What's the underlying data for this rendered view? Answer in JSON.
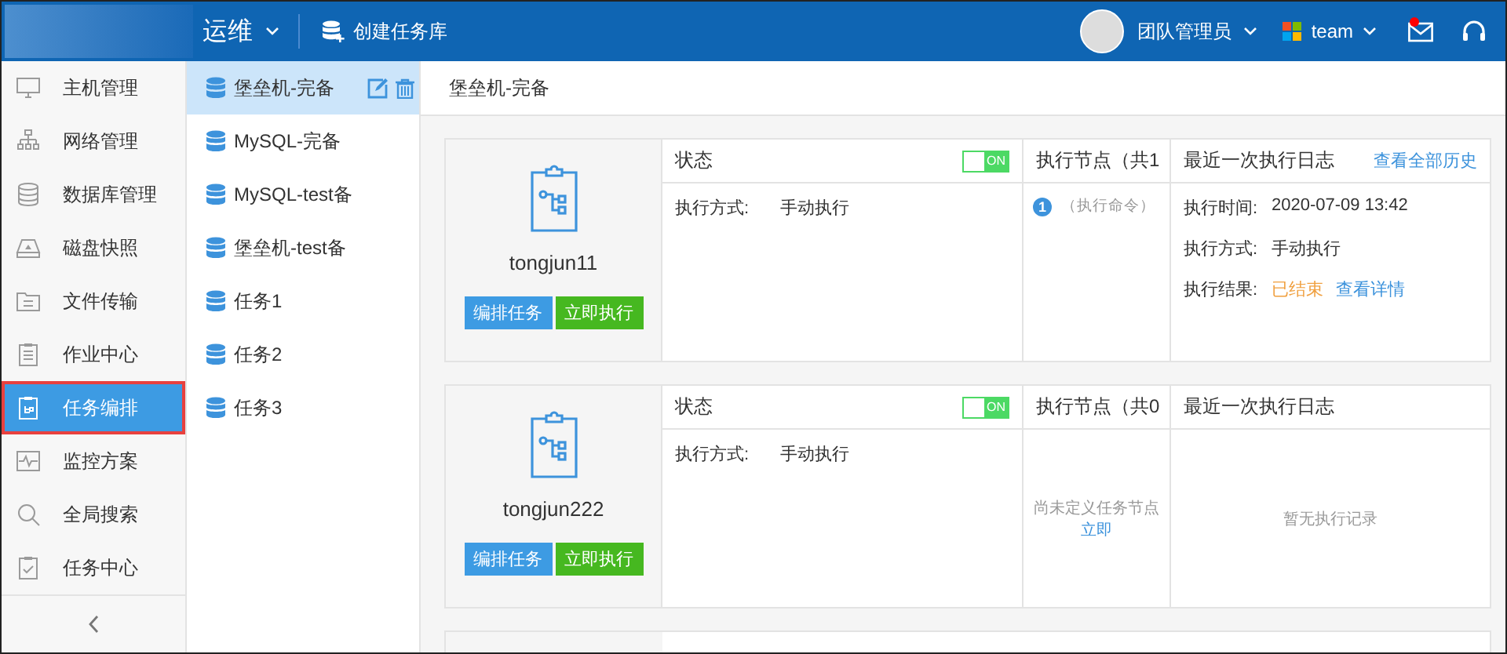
{
  "header": {
    "app_menu": "运维",
    "create_button": "创建任务库",
    "user": "团队管理员",
    "team": "team",
    "mail_unread": true
  },
  "nav": [
    {
      "label": "主机管理",
      "selected": false
    },
    {
      "label": "网络管理",
      "selected": false
    },
    {
      "label": "数据库管理",
      "selected": false
    },
    {
      "label": "磁盘快照",
      "selected": false
    },
    {
      "label": "文件传输",
      "selected": false
    },
    {
      "label": "作业中心",
      "selected": false
    },
    {
      "label": "任务编排",
      "selected": true
    },
    {
      "label": "监控方案",
      "selected": false
    },
    {
      "label": "全局搜索",
      "selected": false
    },
    {
      "label": "任务中心",
      "selected": false
    }
  ],
  "libraries": [
    {
      "label": "堡垒机-完备",
      "selected": true
    },
    {
      "label": "MySQL-完备",
      "selected": false
    },
    {
      "label": "MySQL-test备",
      "selected": false
    },
    {
      "label": "堡垒机-test备",
      "selected": false
    },
    {
      "label": "任务1",
      "selected": false
    },
    {
      "label": "任务2",
      "selected": false
    },
    {
      "label": "任务3",
      "selected": false
    }
  ],
  "breadcrumb": "堡垒机-完备",
  "tasks": [
    {
      "name": "tongjun11",
      "edit_button": "编排任务",
      "run_button": "立即执行",
      "status_title": "状态",
      "on": true,
      "toggle_text": "ON",
      "mode_label": "执行方式:",
      "mode_value": "手动执行",
      "nodes_title": "执行节点（共1",
      "nodes": [
        {
          "index": "1",
          "label": "（执行命令）"
        }
      ],
      "log_title": "最近一次执行日志",
      "history_link": "查看全部历史",
      "log": [
        {
          "kind": "text",
          "label": "执行时间:",
          "value": "2020-07-09 13:42"
        },
        {
          "kind": "text",
          "label": "执行方式:",
          "value": "手动执行"
        },
        {
          "kind": "result",
          "label": "执行结果:",
          "value": "已结束",
          "link": "查看详情"
        }
      ]
    },
    {
      "name": "tongjun222",
      "edit_button": "编排任务",
      "run_button": "立即执行",
      "status_title": "状态",
      "on": true,
      "toggle_text": "ON",
      "mode_label": "执行方式:",
      "mode_value": "手动执行",
      "nodes_title": "执行节点（共0",
      "nodes_empty": "尚未定义任务节点",
      "nodes_empty_link": "立即",
      "log_title": "最近一次执行日志",
      "log_empty": "暂无执行记录"
    }
  ]
}
